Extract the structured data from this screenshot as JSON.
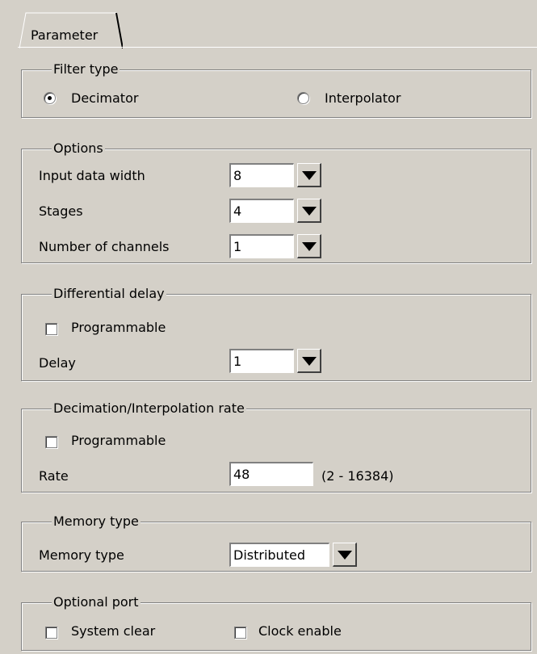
{
  "tabs": [
    {
      "label": "Parameter"
    }
  ],
  "filter_type": {
    "title": "Filter type",
    "options": [
      {
        "label": "Decimator",
        "selected": true
      },
      {
        "label": "Interpolator",
        "selected": false
      }
    ]
  },
  "options": {
    "title": "Options",
    "input_data_width": {
      "label": "Input data width",
      "value": "8"
    },
    "stages": {
      "label": "Stages",
      "value": "4"
    },
    "channels": {
      "label": "Number of channels",
      "value": "1"
    }
  },
  "differential_delay": {
    "title": "Differential delay",
    "programmable": {
      "label": "Programmable",
      "checked": false
    },
    "delay": {
      "label": "Delay",
      "value": "1"
    }
  },
  "rate": {
    "title": "Decimation/Interpolation rate",
    "programmable": {
      "label": "Programmable",
      "checked": false
    },
    "rate": {
      "label": "Rate",
      "value": "48",
      "range": "(2 - 16384)"
    }
  },
  "memory": {
    "title": "Memory type",
    "memory_type": {
      "label": "Memory type",
      "value": "Distributed"
    }
  },
  "optional_port": {
    "title": "Optional port",
    "system_clear": {
      "label": "System clear",
      "checked": false
    },
    "clock_enable": {
      "label": "Clock enable",
      "checked": false
    }
  },
  "icons": {
    "dropdown": "chevron-down-icon",
    "radio_selected": "radio-dot-icon"
  }
}
